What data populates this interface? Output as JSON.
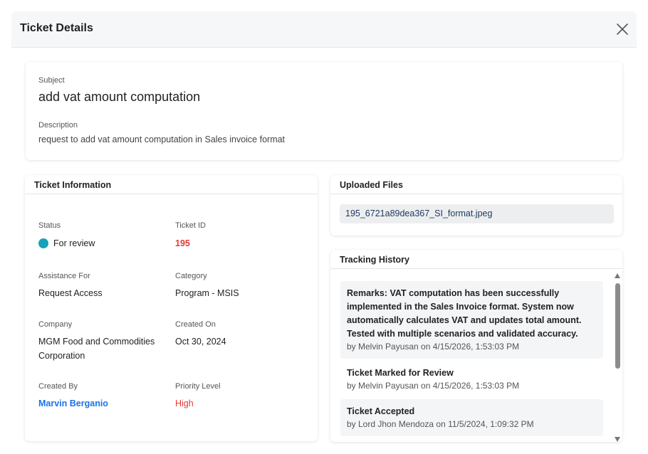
{
  "modal": {
    "title": "Ticket Details",
    "close_icon": "close-icon"
  },
  "subject_card": {
    "subject_label": "Subject",
    "subject_value": "add vat amount computation",
    "description_label": "Description",
    "description_value": "request to add vat amount computation in Sales invoice format"
  },
  "ticket_info": {
    "title": "Ticket Information",
    "status_label": "Status",
    "status_value": "For review",
    "status_color": "#17a2b8",
    "ticket_id_label": "Ticket ID",
    "ticket_id_value": "195",
    "ticket_id_color": "#e53935",
    "assistance_label": "Assistance For",
    "assistance_value": "Request Access",
    "category_label": "Category",
    "category_value": "Program - MSIS",
    "company_label": "Company",
    "company_value": "MGM Food and Commodities Corporation",
    "created_on_label": "Created On",
    "created_on_value": "Oct 30, 2024",
    "created_by_label": "Created By",
    "created_by_value": "Marvin Berganio",
    "created_by_color": "#1a73e8",
    "priority_label": "Priority Level",
    "priority_value": "High",
    "priority_color": "#e53935"
  },
  "uploaded_files": {
    "title": "Uploaded Files",
    "files": [
      "195_6721a89dea367_SI_format.jpeg"
    ]
  },
  "tracking_history": {
    "title": "Tracking History",
    "items": [
      {
        "title": "Remarks: VAT computation has been successfully implemented in the Sales Invoice format. System now automatically calculates VAT and updates total amount. Tested with multiple scenarios and validated accuracy.",
        "meta": "by Melvin Payusan on 4/15/2026, 1:53:03 PM"
      },
      {
        "title": "Ticket Marked for Review",
        "meta": "by Melvin Payusan on 4/15/2026, 1:53:03 PM"
      },
      {
        "title": "Ticket Accepted",
        "meta": "by Lord Jhon Mendoza on 11/5/2024, 1:09:32 PM"
      }
    ]
  }
}
